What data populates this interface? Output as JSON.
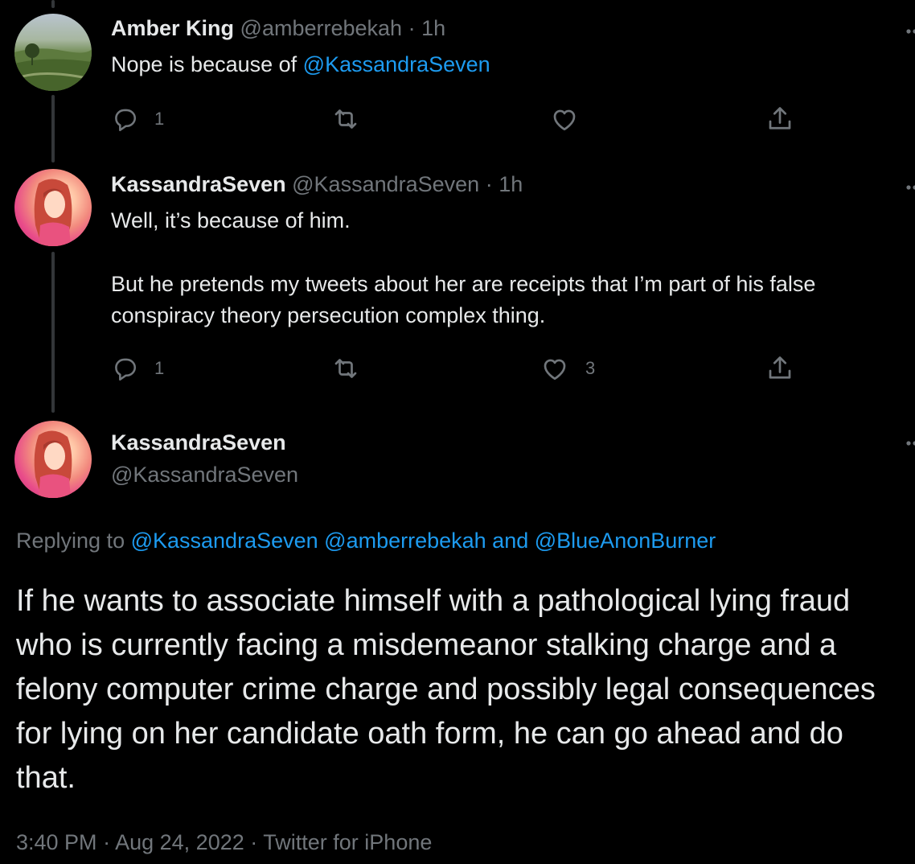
{
  "colors": {
    "background": "#000000",
    "text": "#e7e9ea",
    "secondary": "#71767b",
    "mention": "#1d9bf0",
    "thread_line": "#333639"
  },
  "reply1": {
    "name": "Amber King",
    "handle": "@amberrebekah",
    "sep": "·",
    "time": "1h",
    "text_prefix": "Nope is because of ",
    "mention": "@KassandraSeven",
    "actions": {
      "reply_count": "1",
      "retweet_count": "",
      "like_count": ""
    },
    "avatar_icon": "landscape-avatar"
  },
  "reply2": {
    "name": "KassandraSeven",
    "handle": "@KassandraSeven",
    "sep": "·",
    "time": "1h",
    "line1": "Well, it’s because of him.",
    "line2": "But he pretends my tweets about her are receipts that I’m part of his false conspiracy theory persecution complex thing.",
    "actions": {
      "reply_count": "1",
      "retweet_count": "",
      "like_count": "3"
    },
    "avatar_icon": "anime-avatar"
  },
  "main_tweet": {
    "name": "KassandraSeven",
    "handle": "@KassandraSeven",
    "replying_label": "Replying to ",
    "replying_mention1": "@KassandraSeven",
    "replying_mention2": "@amberrebekah",
    "replying_and": " and ",
    "replying_mention3": "@BlueAnonBurner",
    "text": "If he wants to associate himself with a pathological lying fraud who is currently facing a misdemeanor stalking charge and a felony computer crime charge and possibly legal consequences for lying on her candidate oath form, he can go ahead and do that.",
    "time": "3:40 PM",
    "sep": "·",
    "date": "Aug 24, 2022",
    "source": "Twitter for iPhone",
    "avatar_icon": "anime-avatar"
  }
}
